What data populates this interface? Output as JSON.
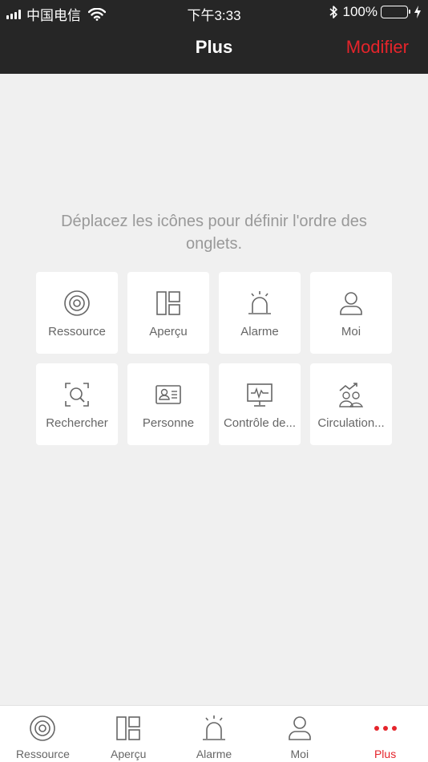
{
  "status": {
    "carrier": "中国电信",
    "time": "下午3:33",
    "battery": "100%",
    "battery_level": 1.0,
    "icons": [
      "signal-icon",
      "wifi-icon",
      "bluetooth-icon",
      "battery-icon",
      "charging-icon"
    ]
  },
  "nav": {
    "title": "Plus",
    "action": "Modifier"
  },
  "hint": "Déplacez les icônes pour définir l'ordre des onglets.",
  "tiles": [
    {
      "label": "Ressource",
      "icon": "resource-icon"
    },
    {
      "label": "Aperçu",
      "icon": "preview-icon"
    },
    {
      "label": "Alarme",
      "icon": "alarm-icon"
    },
    {
      "label": "Moi",
      "icon": "user-icon"
    },
    {
      "label": "Rechercher",
      "icon": "search-icon"
    },
    {
      "label": "Personne",
      "icon": "person-card-icon"
    },
    {
      "label": "Contrôle de...",
      "icon": "monitor-icon"
    },
    {
      "label": "Circulation...",
      "icon": "people-flow-icon"
    }
  ],
  "tabs": [
    {
      "label": "Ressource",
      "icon": "resource-icon"
    },
    {
      "label": "Aperçu",
      "icon": "preview-icon"
    },
    {
      "label": "Alarme",
      "icon": "alarm-icon"
    },
    {
      "label": "Moi",
      "icon": "user-icon"
    },
    {
      "label": "Plus",
      "icon": "more-icon",
      "active": true
    }
  ],
  "colors": {
    "accent": "#e5242b",
    "header_bg": "#262626",
    "page_bg": "#f0f0f0",
    "icon_gray": "#666666"
  }
}
